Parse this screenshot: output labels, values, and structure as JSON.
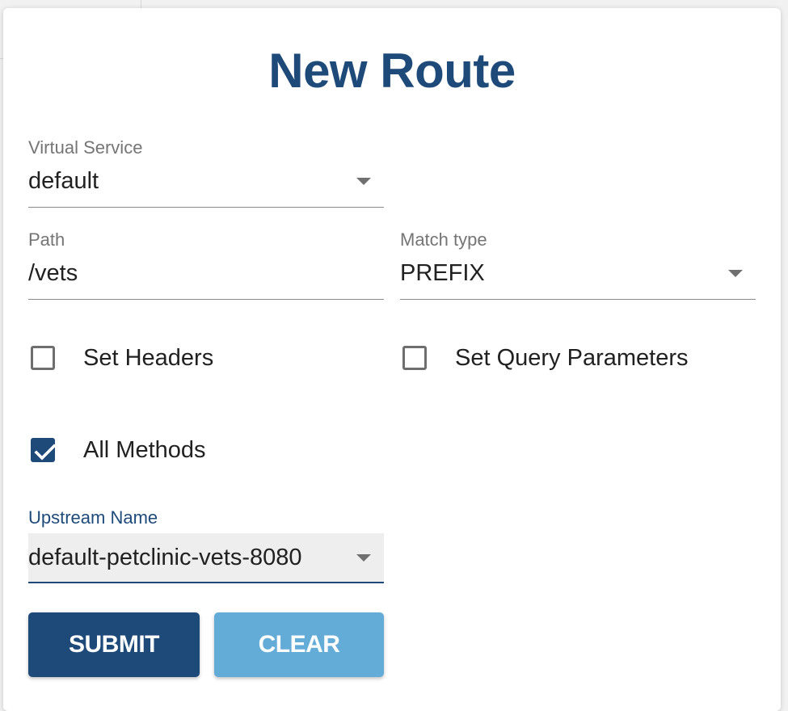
{
  "dialog": {
    "title": "New Route"
  },
  "form": {
    "virtual_service": {
      "label": "Virtual Service",
      "value": "default"
    },
    "path": {
      "label": "Path",
      "value": "/vets"
    },
    "match_type": {
      "label": "Match type",
      "value": "PREFIX"
    },
    "set_headers": {
      "label": "Set Headers",
      "checked": false
    },
    "set_query_parameters": {
      "label": "Set Query Parameters",
      "checked": false
    },
    "all_methods": {
      "label": "All Methods",
      "checked": true
    },
    "upstream_name": {
      "label": "Upstream Name",
      "value": "default-petclinic-vets-8080"
    }
  },
  "actions": {
    "submit_label": "SUBMIT",
    "clear_label": "CLEAR"
  },
  "colors": {
    "primary": "#1e4a7a",
    "secondary": "#64acd8"
  },
  "icons": {
    "dropdown": "caret-down-icon",
    "checked": "checkmark-icon"
  }
}
